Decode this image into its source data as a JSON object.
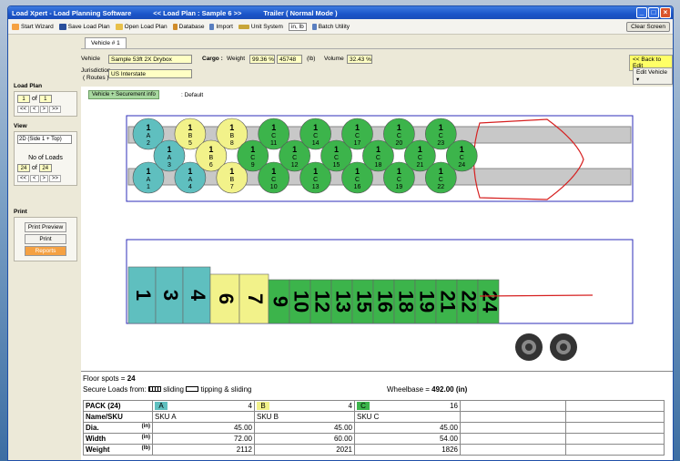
{
  "window": {
    "app_title": "Load Xpert - Load Planning Software",
    "plan_title": "<< Load Plan : Sample 6 >>",
    "mode_title": "Trailer  ( Normal Mode )"
  },
  "toolbar": {
    "start_wizard": "Start Wizard",
    "save_load_plan": "Save Load Plan",
    "open_load_plan": "Open Load Plan",
    "database": "Database",
    "import": "Import",
    "unit_system": "Unit System",
    "unit_value": "in, lb",
    "batch_utility": "Batch Utility",
    "clear_screen": "Clear Screen"
  },
  "vehicle_tab": "Vehicle # 1",
  "header": {
    "vehicle_label": "Vehicle",
    "vehicle_value": "Sample 53ft 2X Drybox",
    "jurisdiction_label": "Jurisdiction",
    "routes_label": "( Routes )",
    "jurisdiction_value": "US Interstate",
    "cargo_label": "Cargo :",
    "weight_label": "Weight",
    "weight_pct": "99.36 %",
    "weight_value": "45748",
    "weight_unit": "(lb)",
    "volume_label": "Volume",
    "volume_pct": "32.43 %",
    "back_to_edit": "<< Back to Edit",
    "edit_vehicle": "Edit Vehicle"
  },
  "sidebar": {
    "load_plan_title": "Load Plan",
    "lp_current": "1",
    "lp_of": "of",
    "lp_total": "1",
    "nav_first": "<<",
    "nav_prev": "<",
    "nav_next": ">",
    "nav_last": ">>",
    "view_title": "View",
    "view_value": "2D (Side 1 + Top)",
    "no_of_loads_label": "No of Loads",
    "loads_current": "24",
    "loads_of": "of",
    "loads_total": "24",
    "print_title": "Print",
    "print_preview": "Print Preview",
    "print": "Print",
    "reports": "Reports"
  },
  "main": {
    "vehicle_securement_button": "Vehicle + Securement info",
    "default_label": ": Default"
  },
  "colors": {
    "A": "#5fbfbf",
    "B": "#f2f28a",
    "C": "#3cb44b"
  },
  "top_view": {
    "items": [
      {
        "n": "1",
        "l": "A",
        "s": "2",
        "g": "A"
      },
      {
        "n": "1",
        "l": "A",
        "s": "1",
        "g": "A"
      },
      {
        "n": "1",
        "l": "A",
        "s": "3",
        "g": "A"
      },
      {
        "n": "1",
        "l": "B",
        "s": "5",
        "g": "B"
      },
      {
        "n": "1",
        "l": "A",
        "s": "4",
        "g": "A"
      },
      {
        "n": "1",
        "l": "B",
        "s": "6",
        "g": "B"
      },
      {
        "n": "1",
        "l": "B",
        "s": "8",
        "g": "B"
      },
      {
        "n": "1",
        "l": "B",
        "s": "7",
        "g": "B"
      },
      {
        "n": "1",
        "l": "C",
        "s": "9",
        "g": "C"
      },
      {
        "n": "1",
        "l": "C",
        "s": "11",
        "g": "C"
      },
      {
        "n": "1",
        "l": "C",
        "s": "10",
        "g": "C"
      },
      {
        "n": "1",
        "l": "C",
        "s": "12",
        "g": "C"
      },
      {
        "n": "1",
        "l": "C",
        "s": "14",
        "g": "C"
      },
      {
        "n": "1",
        "l": "C",
        "s": "13",
        "g": "C"
      },
      {
        "n": "1",
        "l": "C",
        "s": "15",
        "g": "C"
      },
      {
        "n": "1",
        "l": "C",
        "s": "17",
        "g": "C"
      },
      {
        "n": "1",
        "l": "C",
        "s": "16",
        "g": "C"
      },
      {
        "n": "1",
        "l": "C",
        "s": "18",
        "g": "C"
      },
      {
        "n": "1",
        "l": "C",
        "s": "20",
        "g": "C"
      },
      {
        "n": "1",
        "l": "C",
        "s": "19",
        "g": "C"
      },
      {
        "n": "1",
        "l": "C",
        "s": "21",
        "g": "C"
      },
      {
        "n": "1",
        "l": "C",
        "s": "23",
        "g": "C"
      },
      {
        "n": "1",
        "l": "C",
        "s": "22",
        "g": "C"
      },
      {
        "n": "1",
        "l": "C",
        "s": "24",
        "g": "C"
      }
    ]
  },
  "side_view": {
    "labels": [
      "1",
      "3",
      "4",
      "6",
      "7",
      "9",
      "10",
      "12",
      "13",
      "15",
      "16",
      "18",
      "19",
      "21",
      "22",
      "24"
    ],
    "groups": [
      "A",
      "A",
      "A",
      "B",
      "B",
      "C",
      "C",
      "C",
      "C",
      "C",
      "C",
      "C",
      "C",
      "C",
      "C",
      "C"
    ]
  },
  "summary": {
    "floor_spots_label": "Floor spots  =",
    "floor_spots_value": "24",
    "secure_label": "Secure Loads from:",
    "sliding_label": "sliding",
    "tipping_label": "tipping & sliding",
    "wheelbase_label": "Wheelbase =",
    "wheelbase_value": "492.00 (in)"
  },
  "pack_table": {
    "pack_header": "PACK (24)",
    "name_header": "Name/SKU",
    "dia_header": "Dia.",
    "width_header": "Width",
    "weight_header": "Weight",
    "dia_unit": "(in)",
    "width_unit": "(in)",
    "weight_unit": "(lb)",
    "columns": [
      {
        "tag": "A",
        "count": "4",
        "sku": "SKU A",
        "dia": "45.00",
        "width": "72.00",
        "weight": "2112"
      },
      {
        "tag": "B",
        "count": "4",
        "sku": "SKU B",
        "dia": "45.00",
        "width": "60.00",
        "weight": "2021"
      },
      {
        "tag": "C",
        "count": "16",
        "sku": "SKU C",
        "dia": "45.00",
        "width": "54.00",
        "weight": "1826"
      }
    ]
  }
}
